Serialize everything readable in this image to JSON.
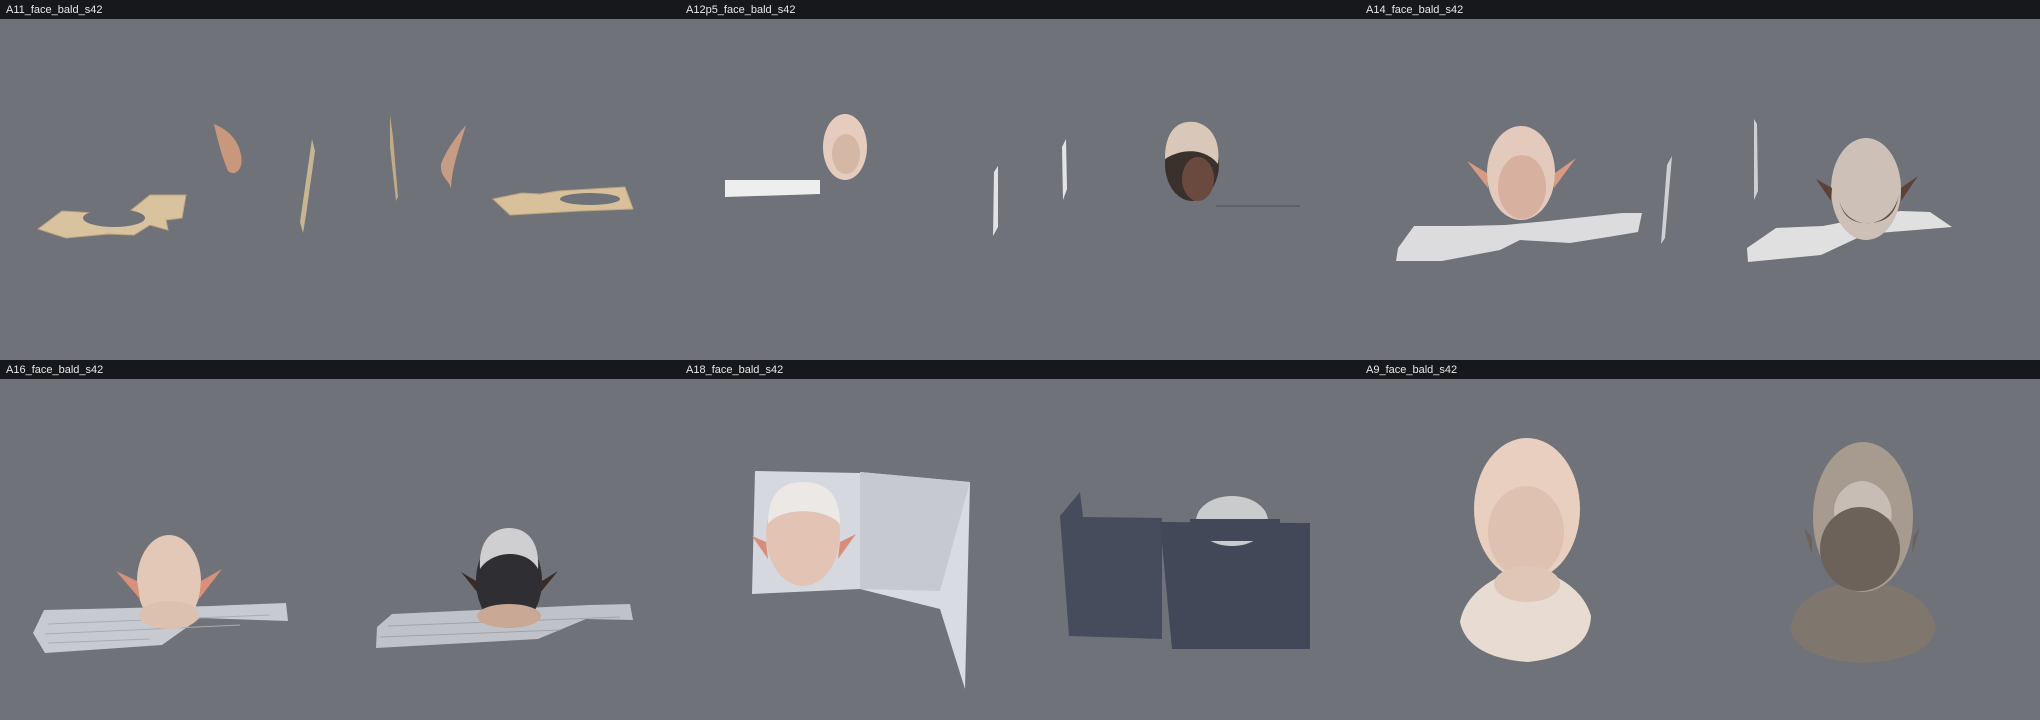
{
  "panels": [
    {
      "title": "A11_face_bald_s42"
    },
    {
      "title": "A12p5_face_bald_s42"
    },
    {
      "title": "A14_face_bald_s42"
    },
    {
      "title": "A16_face_bald_s42"
    },
    {
      "title": "A18_face_bald_s42"
    },
    {
      "title": "A9_face_bald_s42"
    }
  ],
  "colors": {
    "header_bg": "#17181c",
    "header_text": "#e6e7ea",
    "viewport_bg": "#6f7279",
    "skin": "#d9b8a6",
    "skin_shadow": "#a9826e",
    "card_tan": "#d8c2a0",
    "card_grey": "#d8d9dc",
    "slate": "#474c5c",
    "bone": "#e6dbd3"
  }
}
